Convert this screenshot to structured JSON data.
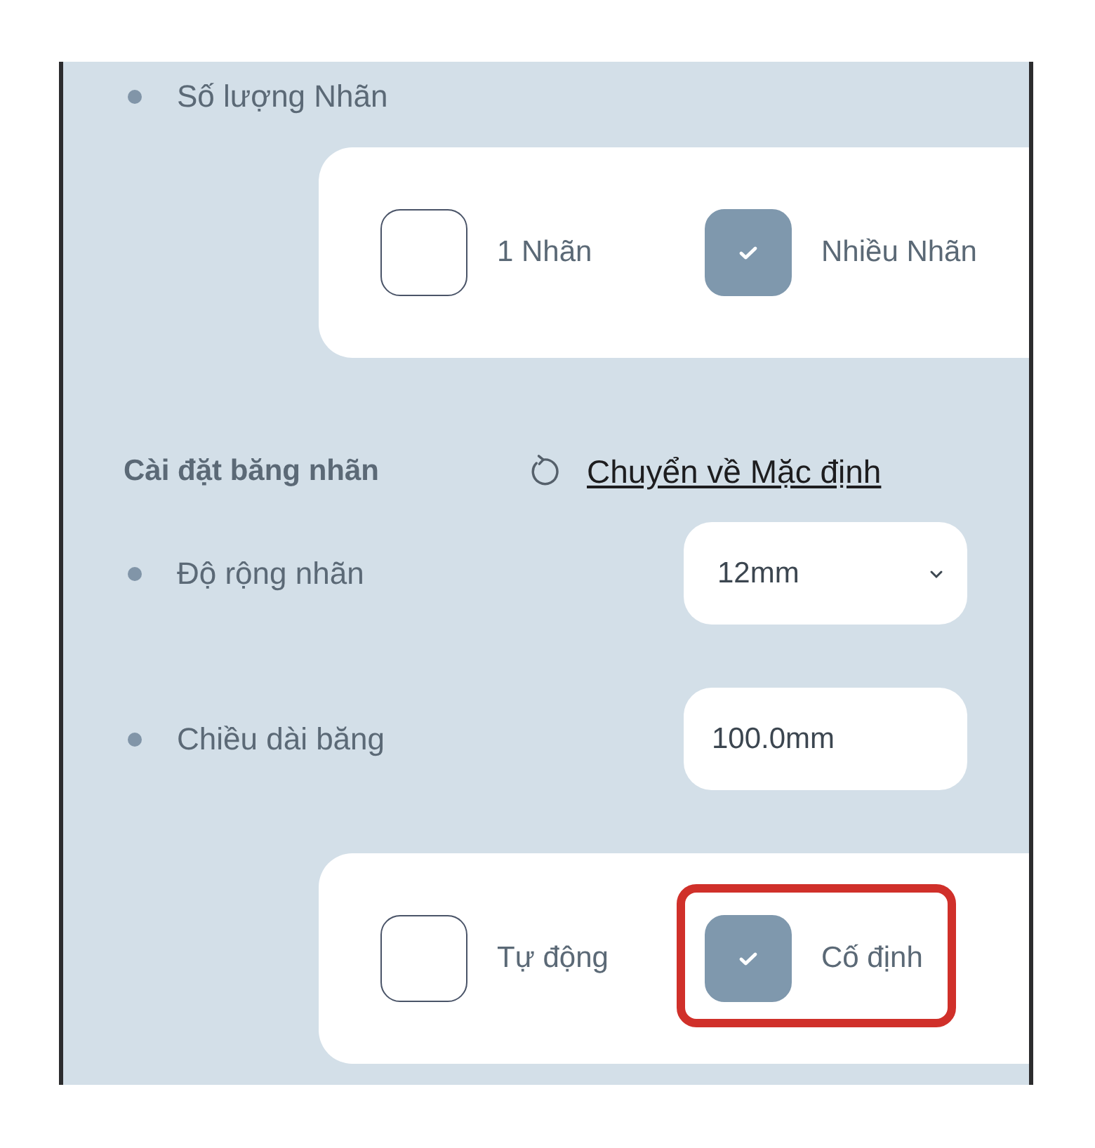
{
  "label_count": {
    "label": "Số lượng Nhãn",
    "options": [
      {
        "label": "1 Nhãn",
        "checked": false,
        "highlighted": false
      },
      {
        "label": "Nhiều Nhãn",
        "checked": true,
        "highlighted": false
      }
    ]
  },
  "tape_settings": {
    "title": "Cài đặt băng nhãn",
    "reset_link": "Chuyển về Mặc định",
    "fields": [
      {
        "kind": "select",
        "label": "Độ rộng nhãn",
        "value": "12mm"
      },
      {
        "kind": "input",
        "label": "Chiều dài băng",
        "value": "100.0mm"
      }
    ],
    "length_mode": {
      "options": [
        {
          "label": "Tự động",
          "checked": false,
          "highlighted": false
        },
        {
          "label": "Cố định",
          "checked": true,
          "highlighted": true
        }
      ]
    }
  }
}
